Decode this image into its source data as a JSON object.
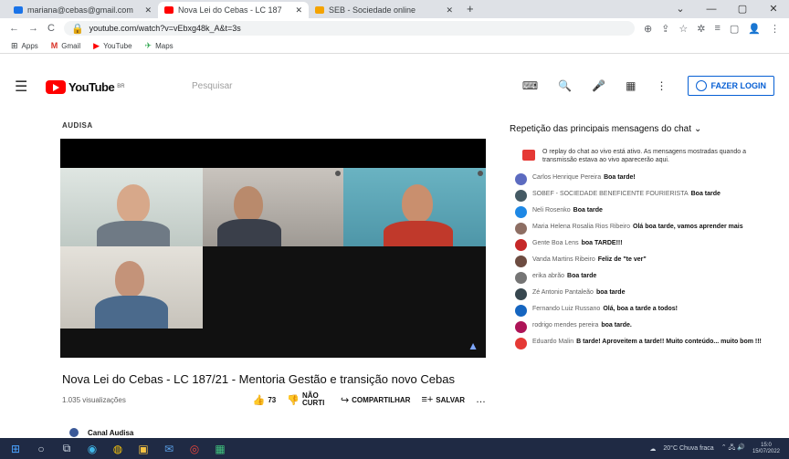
{
  "browser": {
    "tabs": [
      {
        "title": "mariana@cebas@gmail.com",
        "favicon_color": "#1a73e8",
        "close": "✕"
      },
      {
        "title": "Nova Lei do Cebas - LC 187",
        "favicon_color": "#ff0000",
        "close": "✕"
      },
      {
        "title": "SEB - Sociedade online",
        "favicon_color": "#f4a300",
        "close": "✕"
      }
    ],
    "new_tab": "+",
    "window_controls": [
      "⌄",
      "—",
      "▢",
      "✕"
    ],
    "url": "youtube.com/watch?v=vEbxg48k_A&t=3s",
    "bookmarks": [
      {
        "icon": "⊞",
        "label": "Apps"
      },
      {
        "icon": "M",
        "label": "Gmail"
      },
      {
        "icon": "▶",
        "label": "YouTube"
      },
      {
        "icon": "✈",
        "label": "Maps"
      }
    ]
  },
  "youtube": {
    "logo_text": "YouTube",
    "logo_country": "BR",
    "search_placeholder": "Pesquisar",
    "login_label": "FAZER LOGIN"
  },
  "video": {
    "channel_watermark": "AUDISA",
    "title": "Nova Lei do Cebas - LC 187/21 - Mentoria Gestão e transição novo Cebas",
    "views": "1.035 visualizações",
    "actions": [
      {
        "icon": "👍",
        "label": "73"
      },
      {
        "icon": "👎",
        "label": "NÃO CURTI"
      },
      {
        "icon": "↪",
        "label": "COMPARTILHAR"
      },
      {
        "icon": "≡+",
        "label": "SALVAR"
      },
      {
        "icon": "…",
        "label": ""
      }
    ],
    "channel_name": "Canal Audisa"
  },
  "chat": {
    "header": "Repetição das principais mensagens do chat",
    "notice": "O replay do chat ao vivo está ativo. As mensagens mostradas quando a transmissão estava ao vivo aparecerão aqui.",
    "messages": [
      {
        "author": "Carlos Henrique Pereira",
        "text": "Boa tarde!",
        "color": "#5c6bc0"
      },
      {
        "author": "SOBEF - SOCIEDADE BENEFICENTE FOURIERISTA",
        "text": "Boa tarde",
        "color": "#455a64"
      },
      {
        "author": "Neli Rosenko",
        "text": "Boa tarde",
        "color": "#1e88e5"
      },
      {
        "author": "Maria Helena Rosalia Rios Ribeiro",
        "text": "Olá boa tarde, vamos aprender mais",
        "color": "#8d6e63"
      },
      {
        "author": "Gente Boa Lens",
        "text": "boa TARDE!!!",
        "color": "#c62828"
      },
      {
        "author": "Vanda Martins Ribeiro",
        "text": "Feliz de \"te ver\"",
        "color": "#6d4c41"
      },
      {
        "author": "erika abrão",
        "text": "Boa tarde",
        "color": "#757575"
      },
      {
        "author": "Zé Antonio Pantaleão",
        "text": "boa tarde",
        "color": "#37474f"
      },
      {
        "author": "Fernando Luiz Russano",
        "text": "Olá, boa a tarde a todos!",
        "color": "#1565c0"
      },
      {
        "author": "rodrigo mendes pereira",
        "text": "boa tarde.",
        "color": "#ad1457"
      },
      {
        "author": "Eduardo Malin",
        "text": "B tarde! Aproveitem a tarde!! Muito conteúdo... muito bom !!!",
        "color": "#e53935"
      }
    ]
  },
  "taskbar": {
    "icons": [
      "⊞",
      "○",
      "⧉",
      "◉",
      "◍",
      "▣",
      "✉",
      "◎",
      "▦"
    ],
    "weather": "20°C  Chuva fraca",
    "time": "15:0",
    "date": "15/07/2022"
  }
}
